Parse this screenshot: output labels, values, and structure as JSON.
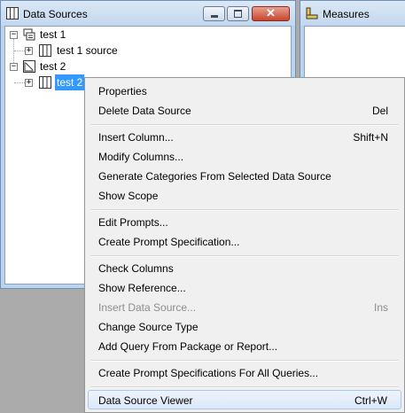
{
  "data_sources_window": {
    "title": "Data Sources",
    "tree": [
      {
        "label": "test 1",
        "expander": "−",
        "icon": "package-icon"
      },
      {
        "label": "test 1 source",
        "expander": "+",
        "icon": "table-icon"
      },
      {
        "label": "test 2",
        "expander": "−",
        "icon": "query-icon"
      },
      {
        "label": "test 2",
        "expander": "+",
        "icon": "table-icon",
        "selected": true
      }
    ]
  },
  "measures_window": {
    "title": "Measures"
  },
  "context_menu": {
    "items": {
      "properties": {
        "label": "Properties",
        "shortcut": ""
      },
      "delete_data_source": {
        "label": "Delete Data Source",
        "shortcut": "Del"
      },
      "insert_column": {
        "label": "Insert Column...",
        "shortcut": "Shift+N"
      },
      "modify_columns": {
        "label": "Modify Columns...",
        "shortcut": ""
      },
      "generate_categories": {
        "label": "Generate Categories From Selected Data Source",
        "shortcut": ""
      },
      "show_scope": {
        "label": "Show Scope",
        "shortcut": ""
      },
      "edit_prompts": {
        "label": "Edit Prompts...",
        "shortcut": ""
      },
      "create_prompt_spec": {
        "label": "Create Prompt Specification...",
        "shortcut": ""
      },
      "check_columns": {
        "label": "Check Columns",
        "shortcut": ""
      },
      "show_reference": {
        "label": "Show Reference...",
        "shortcut": ""
      },
      "insert_data_source": {
        "label": "Insert Data Source...",
        "shortcut": "Ins",
        "disabled": true
      },
      "change_source_type": {
        "label": "Change Source Type",
        "shortcut": ""
      },
      "add_query": {
        "label": "Add Query From Package or Report...",
        "shortcut": ""
      },
      "create_prompt_specs_all": {
        "label": "Create Prompt Specifications For All Queries...",
        "shortcut": ""
      },
      "data_source_viewer": {
        "label": "Data Source Viewer",
        "shortcut": "Ctrl+W",
        "highlighted": true
      }
    }
  },
  "colors": {
    "selection": "#3399ff",
    "window_frame": "#bcd3ec",
    "close_button": "#c7452e",
    "menu_background": "#f0f0f0",
    "disabled_text": "#8d8d8d"
  }
}
